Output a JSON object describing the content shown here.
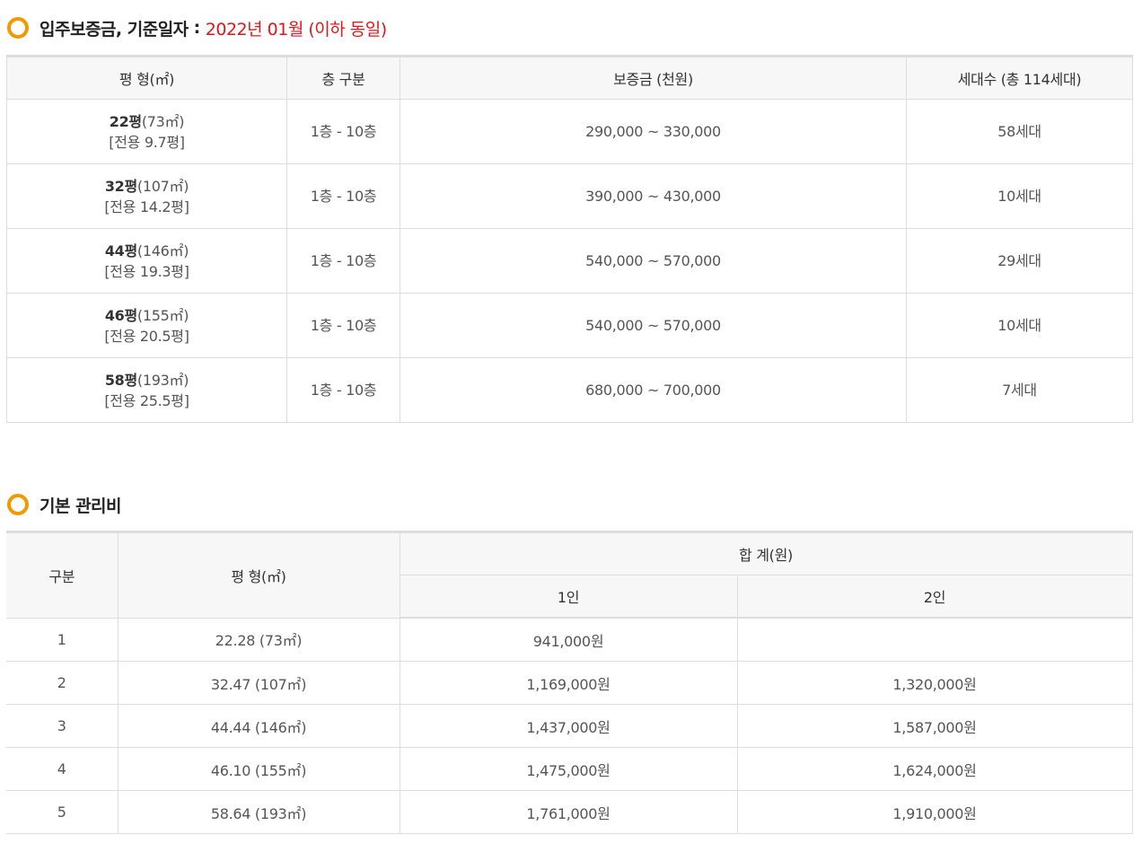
{
  "section1": {
    "title": "입주보증금, 기준일자",
    "separator": ":",
    "accent": "2022년 01월 (이하 동일)",
    "accent_color": "#e0161c",
    "icon": "orange-ring-icon",
    "headers": [
      "평 형(㎡)",
      "층 구분",
      "보증금 (천원)",
      "세대수 (총 114세대)"
    ],
    "rows": [
      {
        "pyeong": "22평",
        "sqm": "(73㎡)",
        "exclusive": "[전용 9.7평]",
        "floor": "1층 - 10층",
        "deposit": "290,000 ~ 330,000",
        "units": "58세대"
      },
      {
        "pyeong": "32평",
        "sqm": "(107㎡)",
        "exclusive": "[전용 14.2평]",
        "floor": "1층 - 10층",
        "deposit": "390,000 ~ 430,000",
        "units": "10세대"
      },
      {
        "pyeong": "44평",
        "sqm": "(146㎡)",
        "exclusive": "[전용 19.3평]",
        "floor": "1층 - 10층",
        "deposit": "540,000 ~ 570,000",
        "units": "29세대"
      },
      {
        "pyeong": "46평",
        "sqm": "(155㎡)",
        "exclusive": "[전용 20.5평]",
        "floor": "1층 - 10층",
        "deposit": "540,000 ~ 570,000",
        "units": "10세대"
      },
      {
        "pyeong": "58평",
        "sqm": "(193㎡)",
        "exclusive": "[전용 25.5평]",
        "floor": "1층 - 10층",
        "deposit": "680,000 ~ 700,000",
        "units": "7세대"
      }
    ]
  },
  "section2": {
    "title": "기본 관리비",
    "icon": "orange-ring-icon",
    "headers": {
      "category": "구분",
      "area": "평 형(㎡)",
      "total": "합 계(원)",
      "one": "1인",
      "two": "2인"
    },
    "rows": [
      {
        "no": "1",
        "area": "22.28 (73㎡)",
        "one": "941,000원",
        "two": ""
      },
      {
        "no": "2",
        "area": "32.47 (107㎡)",
        "one": "1,169,000원",
        "two": "1,320,000원"
      },
      {
        "no": "3",
        "area": "44.44 (146㎡)",
        "one": "1,437,000원",
        "two": "1,587,000원"
      },
      {
        "no": "4",
        "area": "46.10 (155㎡)",
        "one": "1,475,000원",
        "two": "1,624,000원"
      },
      {
        "no": "5",
        "area": "58.64 (193㎡)",
        "one": "1,761,000원",
        "two": "1,910,000원"
      }
    ]
  }
}
